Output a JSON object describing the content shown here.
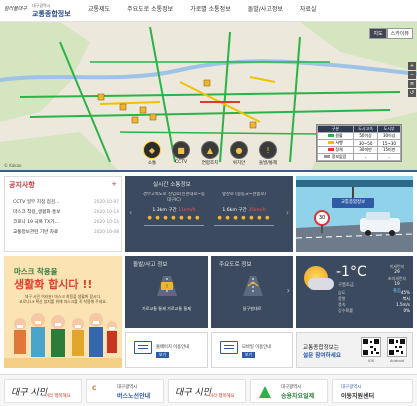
{
  "header": {
    "logo_script": "컬러풀대구",
    "logo_line1": "대구광역시",
    "logo_line2": "교통종합정보",
    "nav": [
      "교통제도",
      "주요도로 소통정보",
      "가로별 소통정보",
      "돌발/사고정보",
      "자료실"
    ]
  },
  "map": {
    "view_buttons": [
      "지도",
      "스카이뷰"
    ],
    "categories": [
      {
        "label": "소통",
        "icon": "traffic-icon"
      },
      {
        "label": "CCTV",
        "icon": "cctv-icon"
      },
      {
        "label": "연합조치",
        "icon": "joint-action-icon"
      },
      {
        "label": "위치안",
        "icon": "location-icon"
      },
      {
        "label": "돌발/통제",
        "icon": "incident-icon"
      }
    ],
    "attribution": "© Kakao",
    "legend": {
      "headers": [
        "구분",
        "도시고속",
        "도시부"
      ],
      "rows": [
        {
          "color": "#2bb34a",
          "label": "원활",
          "a": "50이상",
          "b": "30이상"
        },
        {
          "color": "#f2c200",
          "label": "서행",
          "a": "30~50",
          "b": "15~30"
        },
        {
          "color": "#e03a2b",
          "label": "정체",
          "a": "30미만",
          "b": "15미만"
        },
        {
          "color": "#9a9a9a",
          "label": "정보없음",
          "a": "-",
          "b": "-"
        }
      ]
    }
  },
  "notice": {
    "title": "공지사항",
    "more": "+",
    "items": [
      {
        "title": "CCTV 일부 지점 점검...",
        "date": "2020-10-07"
      },
      {
        "title": "마스크 착용_생활화 홍보",
        "date": "2020-10-14"
      },
      {
        "title": "코로나 19 극복 TX가...",
        "date": "2020-10-14"
      },
      {
        "title": "교통정보관련 기반 자료",
        "date": "2020-10-08"
      }
    ]
  },
  "traffic": {
    "title": "실시간 소통정보",
    "routes": [
      {
        "name": "경부고속도로 진입로(신천대로~동대구IC)",
        "distance": "1.3km 구간",
        "speed": "11km/h",
        "dots": "● ● ● ● ● ● ●"
      },
      {
        "name": "앞산로 (중동교~현충로)",
        "distance": "1.6km 구간",
        "speed": "35km/h",
        "dots": "● ● ● ● ● ● ●"
      }
    ]
  },
  "cam_panel": {
    "sign": "교통종합정보",
    "speed_sign": "30"
  },
  "banner": {
    "head": "마스크 착용을",
    "main": "생활화 합시다 !!",
    "sub1": "대구 시민 여러분! 마스크 착용을 생활화 합시다.",
    "sub2": "코로나19 확산 방지를 위해 마스크를 꼭 착용해 주세요."
  },
  "accident": {
    "title": "돌발/사고 정보",
    "caption": "가로교통 통제 가로교통 통제"
  },
  "roadinfo": {
    "title": "주요도로 정보",
    "caption": "달구벌대로"
  },
  "weather": {
    "temp": "-1°C",
    "desc": "구름조금",
    "rows": [
      {
        "label": "습도",
        "value": "45%"
      },
      {
        "label": "풍향",
        "value": "북서"
      },
      {
        "label": "풍속",
        "value": "1.5m/s"
      },
      {
        "label": "강수확률",
        "value": "0%"
      }
    ],
    "air_label": "미세먼지",
    "air_value": "29",
    "fine_label": "초미세먼지",
    "fine_value": "19",
    "air_grade": "좋음"
  },
  "services": [
    {
      "text": "홈페이지 이용안내",
      "button": "보기"
    },
    {
      "text": "모바일 이용안내",
      "button": "보기"
    }
  ],
  "survey": {
    "line1": "교통종합정보는",
    "line2": "설문 참여하세요",
    "qr1": "iOS",
    "qr2": "Android"
  },
  "footer": [
    {
      "kind": "callig",
      "text1": "대구 시민",
      "text2": "이라 행복해요"
    },
    {
      "kind": "label",
      "text1": "대구광역시",
      "text2": "버스노선안내"
    },
    {
      "kind": "callig",
      "text1": "대구 시민",
      "text2": "이라 행복해요"
    },
    {
      "kind": "label",
      "text1": "대구광역시",
      "text2": "승용차요일제"
    },
    {
      "kind": "label",
      "text1": "대구광역시",
      "text2": "이동지원센터"
    }
  ]
}
